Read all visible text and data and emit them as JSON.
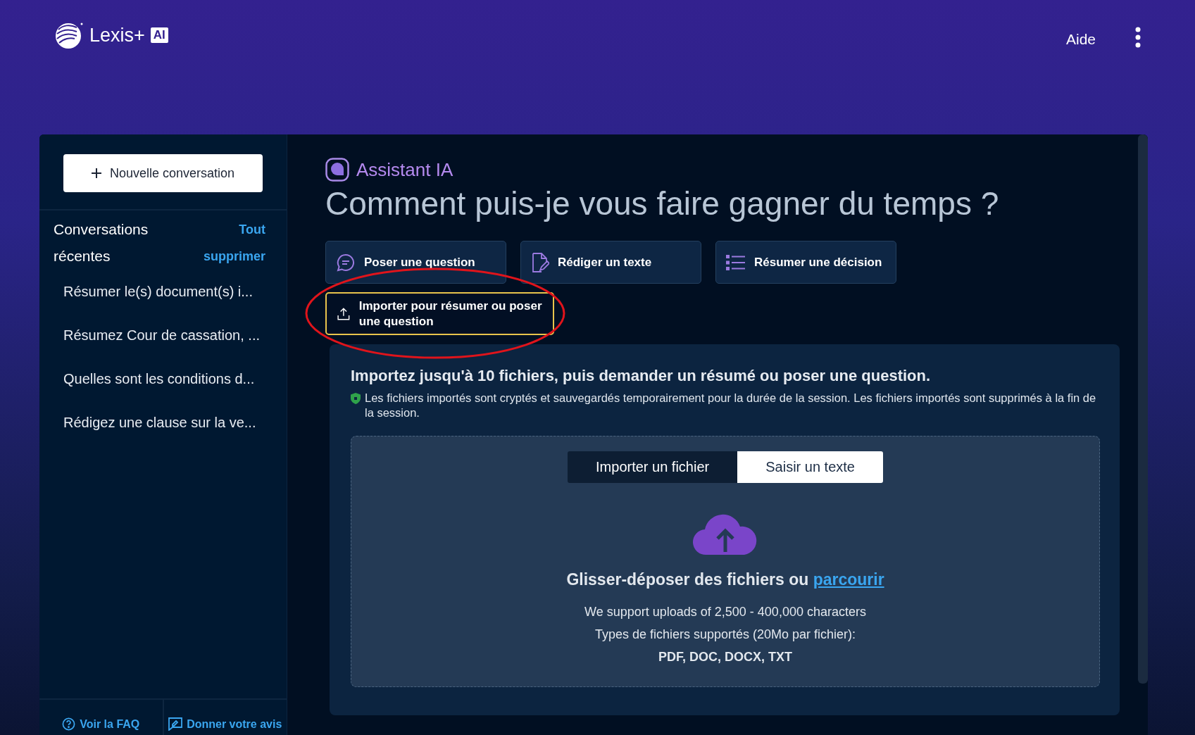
{
  "header": {
    "brand": "Lexis+",
    "brand_badge": "AI",
    "help": "Aide"
  },
  "sidebar": {
    "new_button": "Nouvelle conversation",
    "recent_title": "Conversations récentes",
    "clear_all": "Tout supprimer",
    "items": [
      {
        "label": "Résumer le(s) document(s) i..."
      },
      {
        "label": "Résumez Cour de cassation, ..."
      },
      {
        "label": "Quelles sont les conditions d..."
      },
      {
        "label": "Rédigez une clause sur la ve..."
      }
    ],
    "footer": [
      {
        "kind": "faq",
        "label": "Voir la FAQ"
      },
      {
        "kind": "feedback",
        "label": "Donner votre avis"
      }
    ]
  },
  "main": {
    "assistant_label": "Assistant IA",
    "heading": "Comment puis-je vous faire gagner du temps ?",
    "actions": [
      {
        "kind": "question",
        "label": "Poser une question",
        "focused": false
      },
      {
        "kind": "draft",
        "label": "Rédiger un texte",
        "focused": false
      },
      {
        "kind": "summary",
        "label": "Résumer une décision",
        "focused": false
      },
      {
        "kind": "upload",
        "label": "Importer pour résumer ou poser une question",
        "focused": true
      }
    ],
    "upload": {
      "title": "Importez jusqu'à 10 fichiers, puis demander un résumé ou poser une question.",
      "note": "Les fichiers importés sont cryptés et sauvegardés temporairement pour la durée de la session. Les fichiers importés sont supprimés à la fin de la session.",
      "tabs": [
        {
          "label": "Importer un fichier",
          "selected": true
        },
        {
          "label": "Saisir un texte",
          "selected": false
        }
      ],
      "drop_text": "Glisser-déposer des fichiers ou",
      "browse_link": "parcourir",
      "support_lines": [
        "We support uploads of 2,500 - 400,000 characters",
        "Types de fichiers supportés (20Mo par fichier):"
      ],
      "formats": "PDF, DOC, DOCX, TXT"
    }
  }
}
